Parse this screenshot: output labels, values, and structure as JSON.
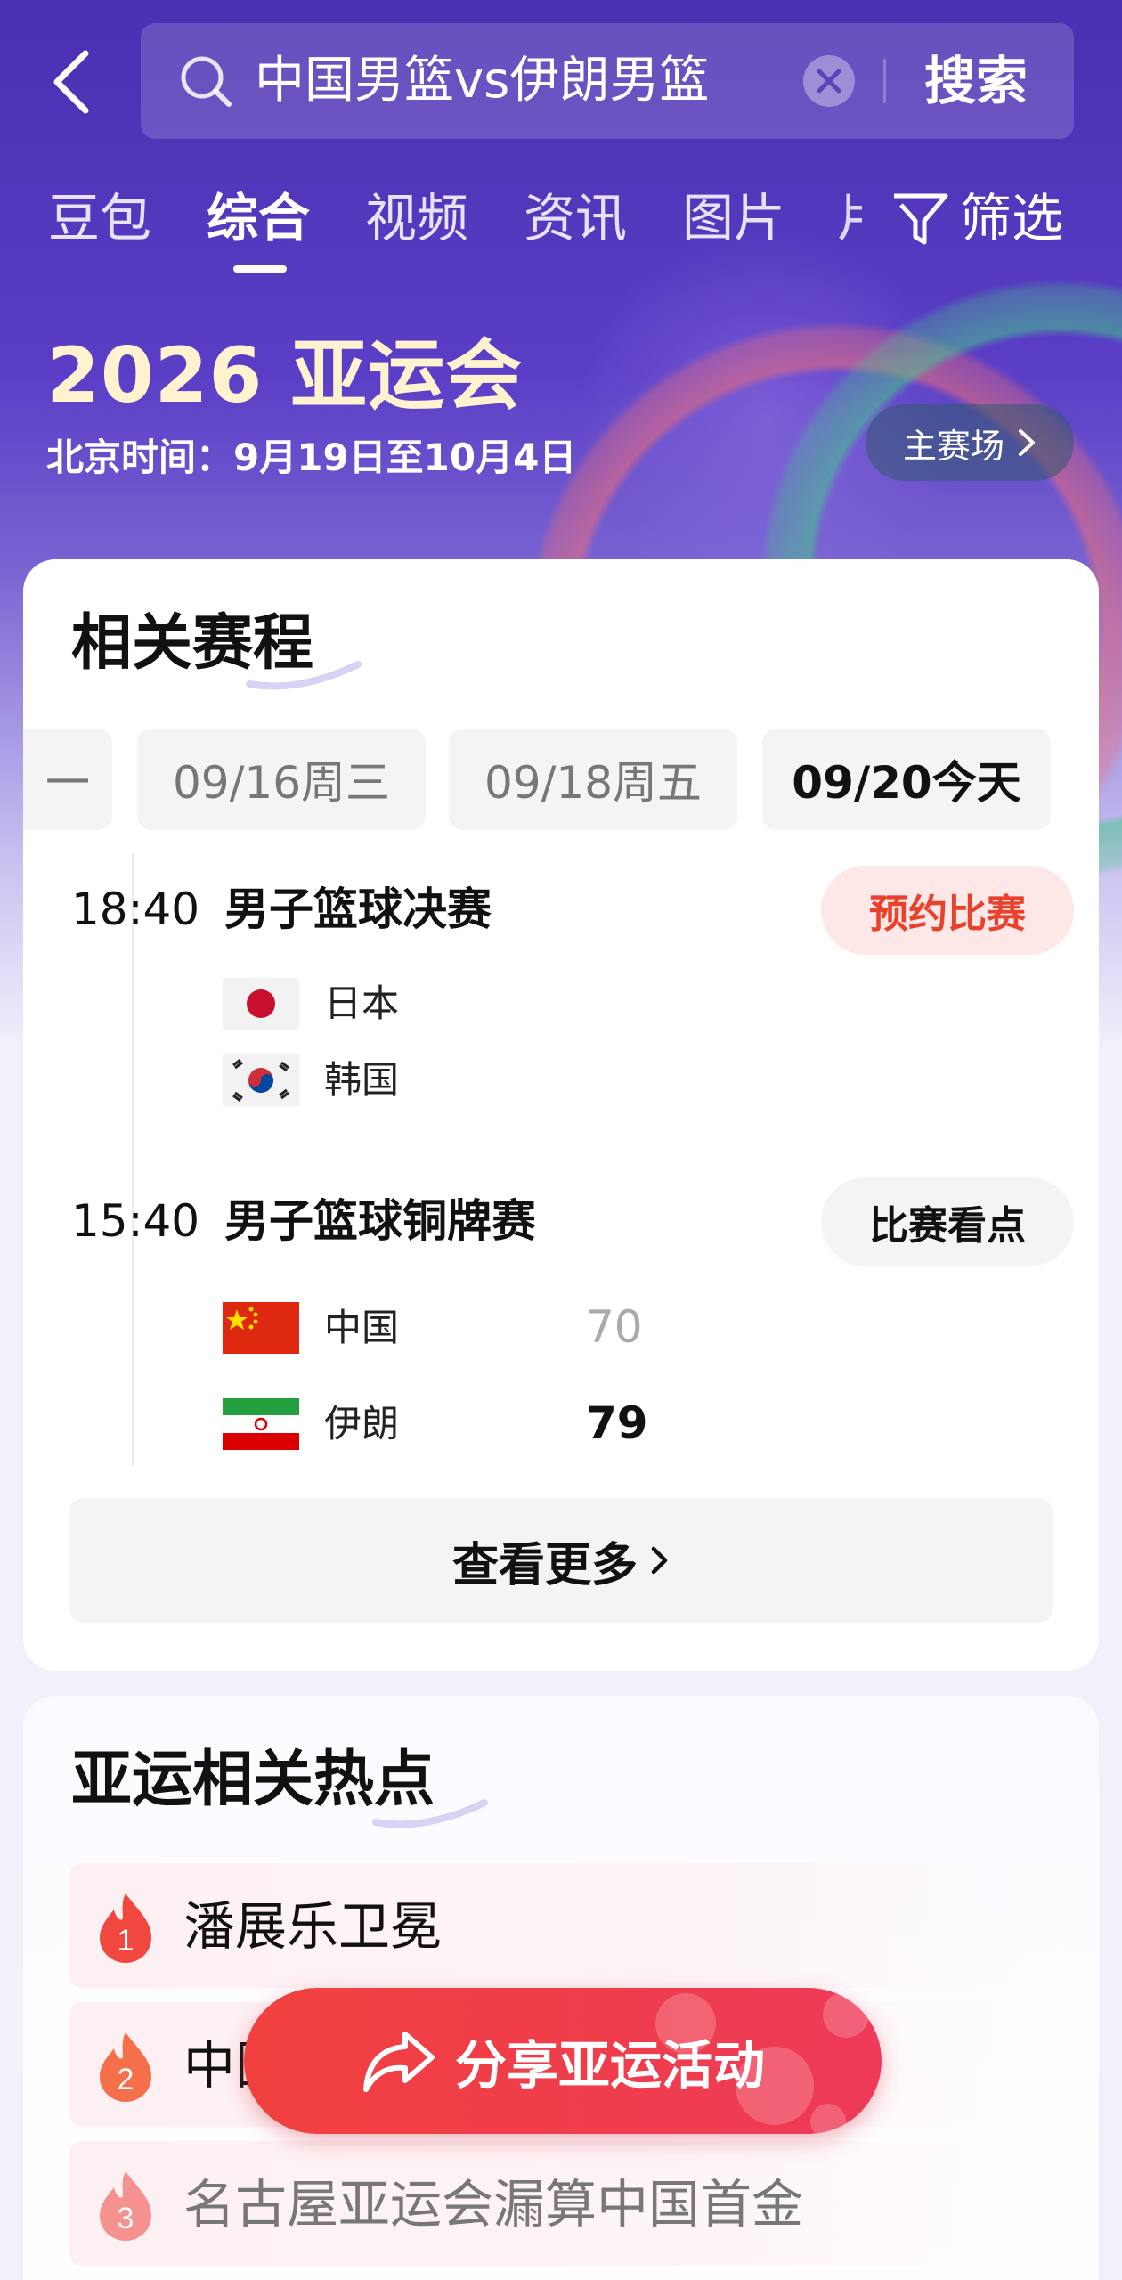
{
  "header": {
    "back_icon": "chevron-left-icon",
    "search_query": "中国男篮vs伊朗男篮",
    "search_button": "搜索"
  },
  "tabs": {
    "items": [
      "豆包",
      "综合",
      "视频",
      "资讯",
      "图片"
    ],
    "active": "综合",
    "cut_off": "片",
    "filter_label": "筛选"
  },
  "event": {
    "title": "2026 亚运会",
    "dates": "北京时间：9月19日至10月4日",
    "venue_button": "主赛场"
  },
  "schedule": {
    "title": "相关赛程",
    "date_tabs": [
      {
        "label": "一",
        "active": false
      },
      {
        "label": "09/16周三",
        "active": false
      },
      {
        "label": "09/18周五",
        "active": false
      },
      {
        "label": "09/20今天",
        "active": true
      }
    ],
    "games": [
      {
        "time": "18:40",
        "name": "男子篮球决赛",
        "action": "预约比赛",
        "teams": [
          {
            "name": "日本",
            "flag": "japan-flag",
            "score": ""
          },
          {
            "name": "韩国",
            "flag": "korea-flag",
            "score": ""
          }
        ]
      },
      {
        "time": "15:40",
        "name": "男子篮球铜牌赛",
        "action": "比赛看点",
        "teams": [
          {
            "name": "中国",
            "flag": "china-flag",
            "score": "70"
          },
          {
            "name": "伊朗",
            "flag": "iran-flag",
            "score": "79"
          }
        ]
      }
    ],
    "more_button": "查看更多"
  },
  "hot_topics": {
    "title": "亚运相关热点",
    "items": [
      {
        "rank": "1",
        "text": "潘展乐卫冕"
      },
      {
        "rank": "2",
        "text": "中国"
      },
      {
        "rank": "3",
        "text": "名古屋亚运会漏算中国首金"
      }
    ]
  },
  "share": {
    "label": "分享亚运活动"
  },
  "colors": {
    "brand_purple": "#4a2fb0",
    "title_gold": "#fff2cf",
    "accent_red": "#f0413e",
    "hot_rank_red": "#f0473f"
  }
}
